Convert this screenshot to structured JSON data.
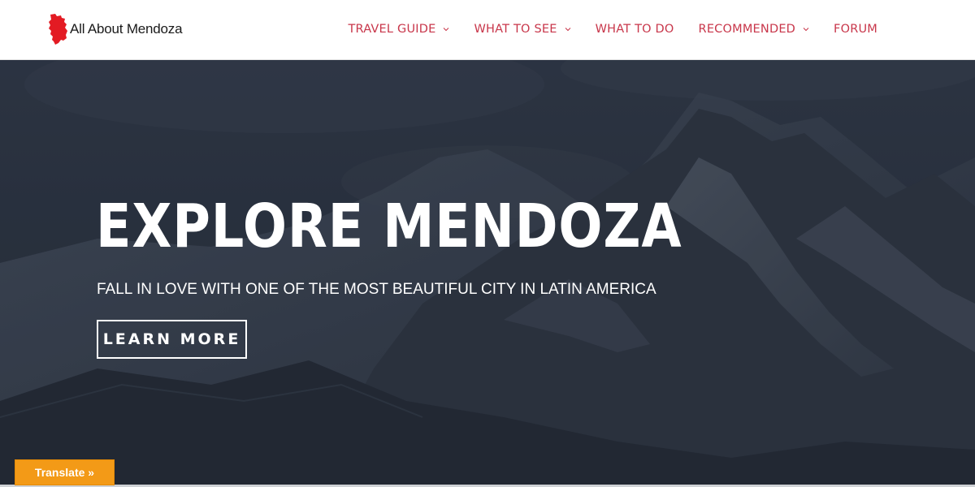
{
  "site": {
    "name": "All About Mendoza",
    "logo_icon": "mendoza-map-icon",
    "logo_color": "#e31b23"
  },
  "nav": {
    "items": [
      {
        "label": "TRAVEL GUIDE",
        "has_dropdown": true
      },
      {
        "label": "WHAT TO SEE",
        "has_dropdown": true
      },
      {
        "label": "WHAT TO DO",
        "has_dropdown": false
      },
      {
        "label": "RECOMMENDED",
        "has_dropdown": true
      },
      {
        "label": "FORUM",
        "has_dropdown": false
      }
    ],
    "color": "#c8364a"
  },
  "hero": {
    "title": "EXPLORE MENDOZA",
    "subtitle": "FALL IN LOVE WITH ONE OF THE MOST BEAUTIFUL CITY IN LATIN AMERICA",
    "button_label": "LEARN MORE",
    "background": "mountain-photo"
  },
  "translate": {
    "label": "Translate »",
    "color": "#f39a17"
  }
}
